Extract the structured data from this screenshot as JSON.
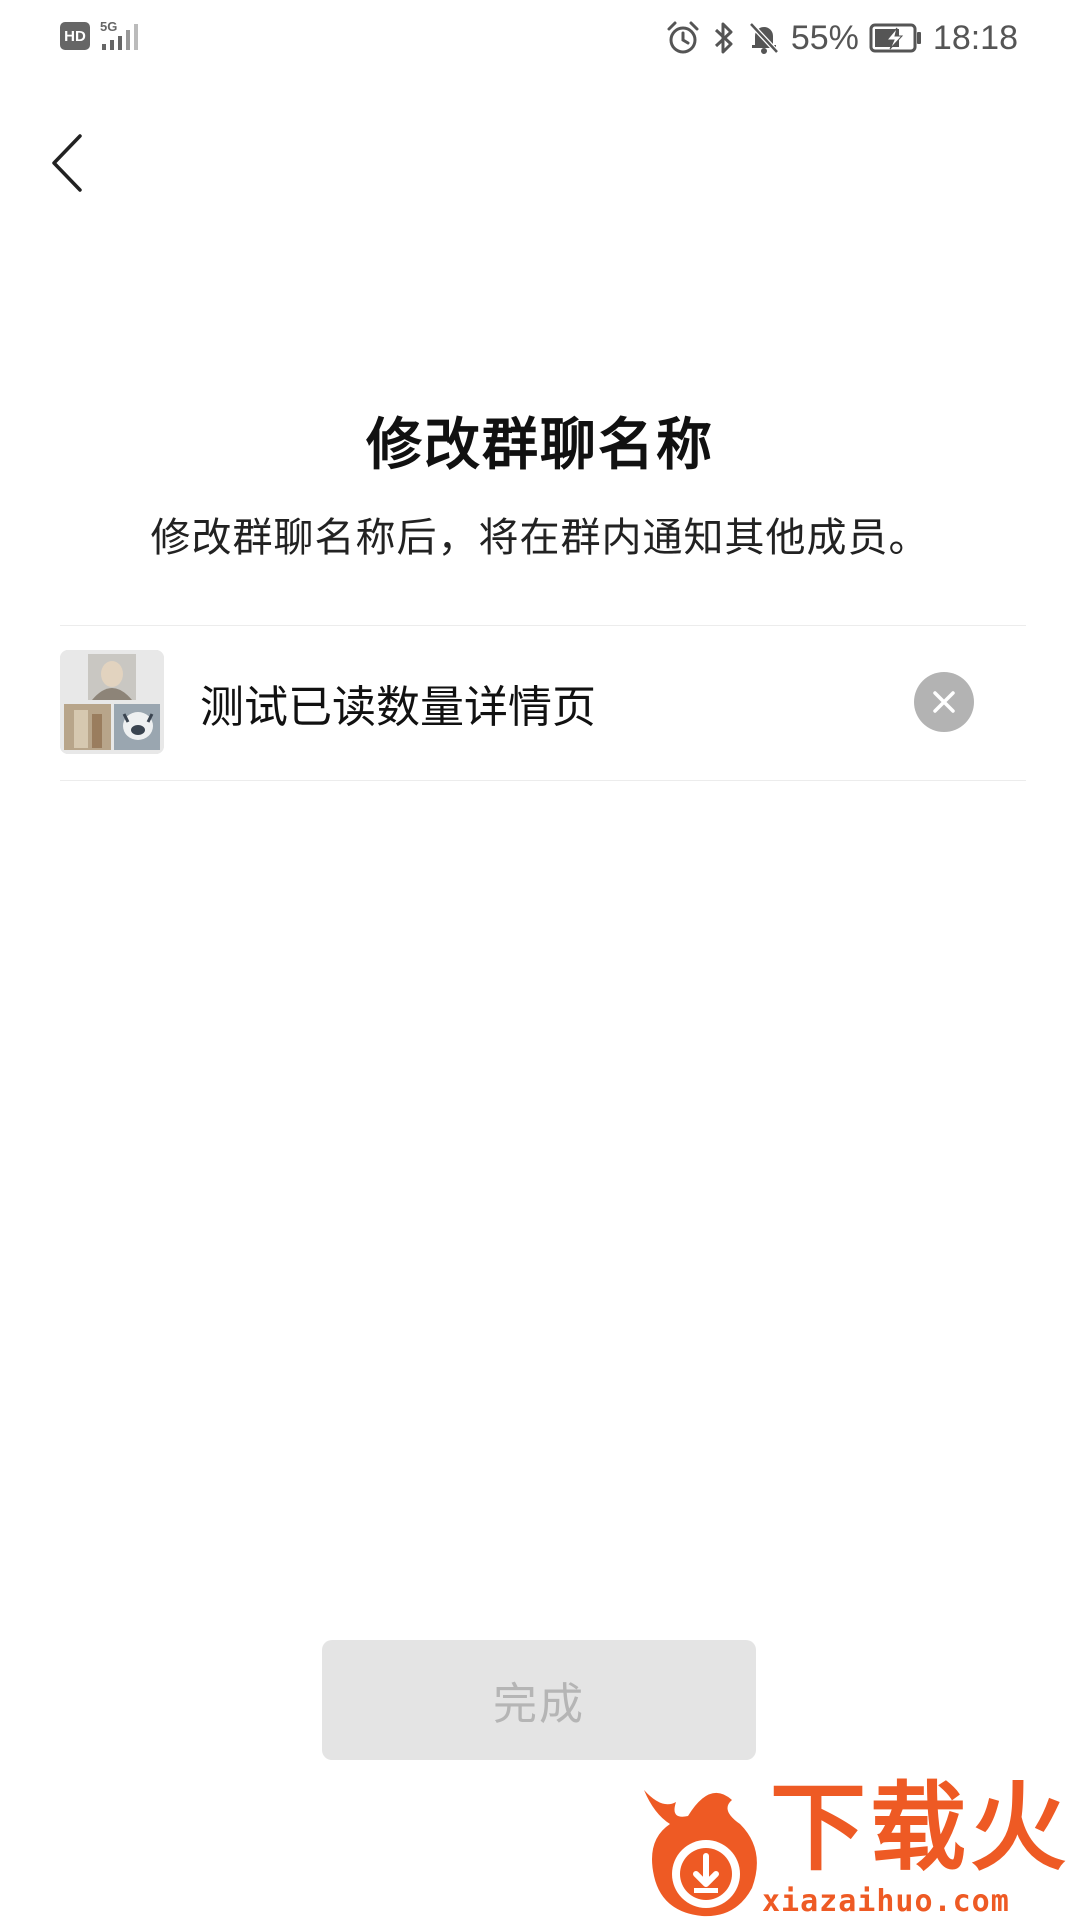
{
  "status_bar": {
    "hd_label": "HD",
    "network": "5G",
    "battery": "55%",
    "time": "18:18"
  },
  "header": {
    "title": "修改群聊名称",
    "subtitle": "修改群聊名称后，将在群内通知其他成员。"
  },
  "group": {
    "name_value": "测试已读数量详情页"
  },
  "footer": {
    "done_label": "完成"
  },
  "watermark": {
    "brand": "下载火",
    "url": "xiazaihuo.com"
  },
  "colors": {
    "watermark_orange": "#ee5a24",
    "done_bg": "#e4e4e4",
    "done_text": "#b5b5b5",
    "clear_bg": "#b3b3b3"
  }
}
